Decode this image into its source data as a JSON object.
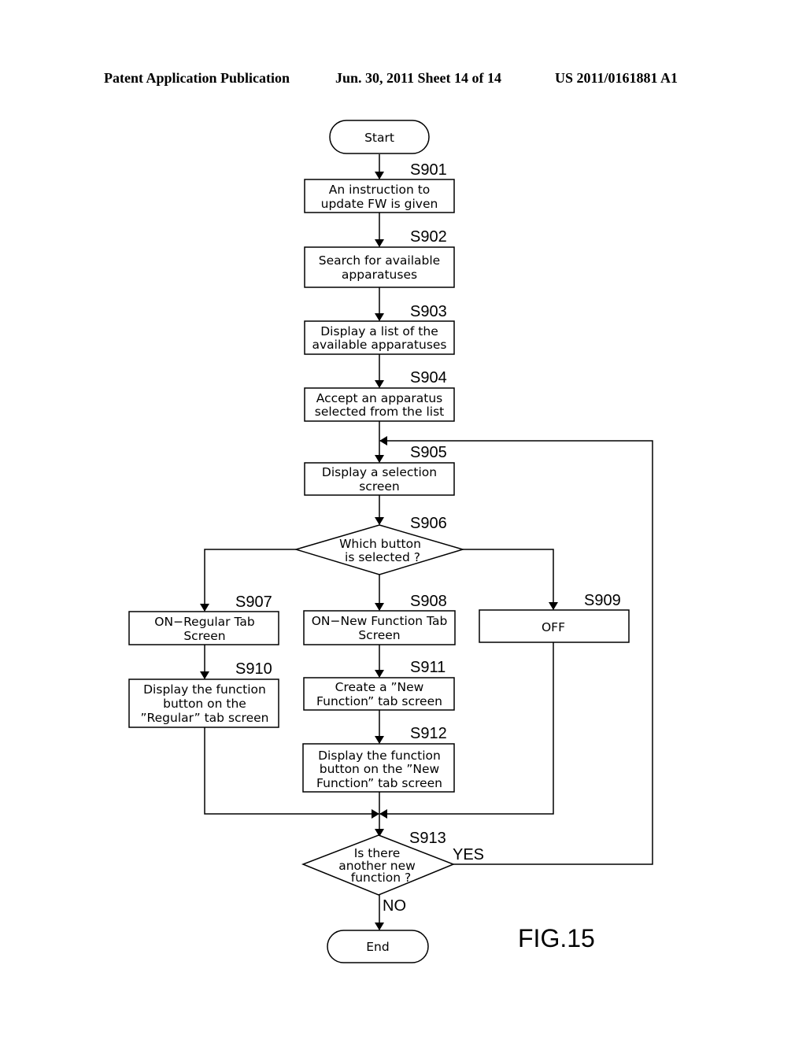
{
  "header": {
    "publication": "Patent Application Publication",
    "date_sheet": "Jun. 30, 2011  Sheet 14 of 14",
    "pub_number": "US 2011/0161881 A1"
  },
  "figure_label": "FIG.15",
  "flowchart": {
    "start": "Start",
    "end": "End",
    "steps": {
      "s901": {
        "id": "S901",
        "lines": [
          "An instruction to",
          "update FW is given"
        ]
      },
      "s902": {
        "id": "S902",
        "lines": [
          "Search for available",
          "apparatuses"
        ]
      },
      "s903": {
        "id": "S903",
        "lines": [
          "Display a list of the",
          "available apparatuses"
        ]
      },
      "s904": {
        "id": "S904",
        "lines": [
          "Accept an apparatus",
          "selected from the list"
        ]
      },
      "s905": {
        "id": "S905",
        "lines": [
          "Display a selection",
          "screen"
        ]
      },
      "s906": {
        "id": "S906",
        "lines": [
          "Which button",
          "is selected ?"
        ]
      },
      "s907": {
        "id": "S907",
        "lines": [
          "ON−Regular Tab",
          "Screen"
        ]
      },
      "s908": {
        "id": "S908",
        "lines": [
          "ON−New Function Tab",
          "Screen"
        ]
      },
      "s909": {
        "id": "S909",
        "lines": [
          "OFF"
        ]
      },
      "s910": {
        "id": "S910",
        "lines": [
          "Display the function",
          "button on the",
          "”Regular” tab screen"
        ]
      },
      "s911": {
        "id": "S911",
        "lines": [
          "Create a ”New",
          "Function” tab screen"
        ]
      },
      "s912": {
        "id": "S912",
        "lines": [
          "Display the function",
          "button on the ”New",
          "Function” tab screen"
        ]
      },
      "s913": {
        "id": "S913",
        "lines": [
          "Is there",
          "another new",
          "function ?"
        ]
      }
    },
    "branch_labels": {
      "yes": "YES",
      "no": "NO"
    }
  }
}
